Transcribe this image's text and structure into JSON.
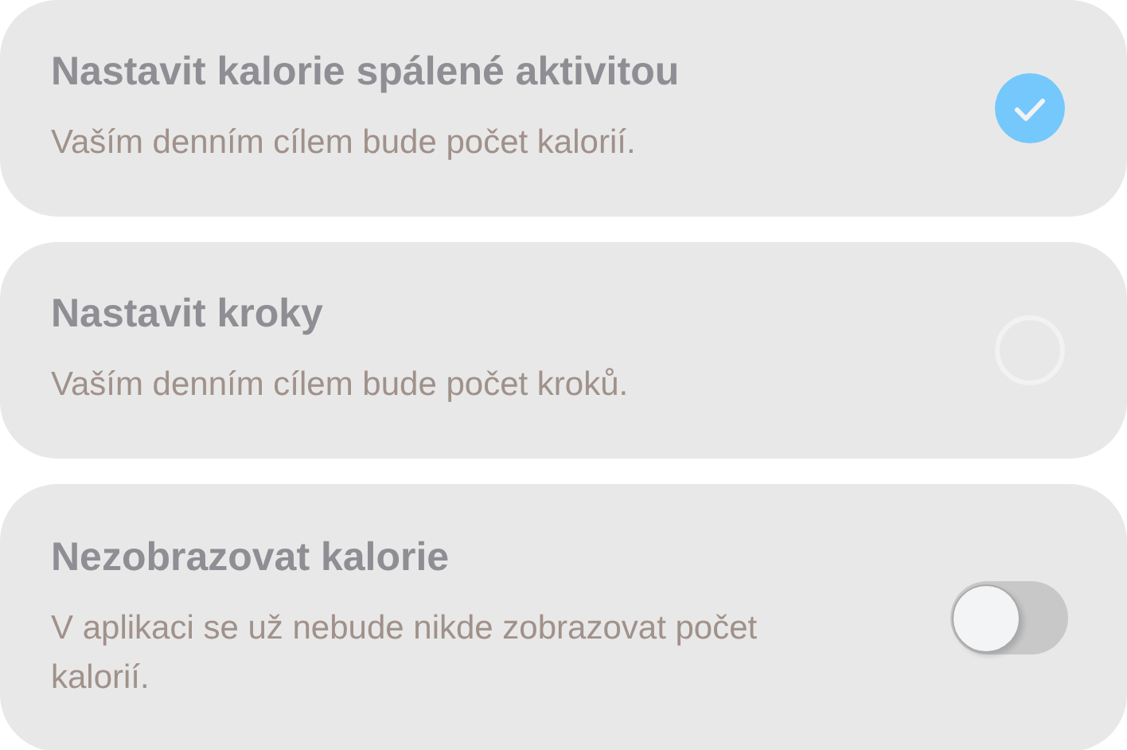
{
  "options": [
    {
      "kind": "radio",
      "title": "Nastavit kalorie spálené aktivitou",
      "description": "Vaším denním cílem bude počet kalorií.",
      "selected": true
    },
    {
      "kind": "radio",
      "title": "Nastavit kroky",
      "description": "Vaším denním cílem bude počet kroků.",
      "selected": false
    },
    {
      "kind": "toggle",
      "title": "Nezobrazovat kalorie",
      "description": "V aplikaci se už nebude nikde zobrazovat počet kalorií.",
      "on": false
    }
  ]
}
